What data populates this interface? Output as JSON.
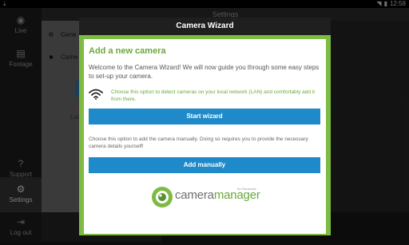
{
  "status_bar": {
    "time": "12:58"
  },
  "sidebar": {
    "items": [
      {
        "label": "Live",
        "icon": "eye-icon",
        "glyph": "◉"
      },
      {
        "label": "Footage",
        "icon": "film-icon",
        "glyph": "▤"
      },
      {
        "label": "Support",
        "icon": "question-icon",
        "glyph": "?"
      },
      {
        "label": "Settings",
        "icon": "gear-icon",
        "glyph": "⚙"
      },
      {
        "label": "Log out",
        "icon": "logout-icon",
        "glyph": "⇥"
      }
    ],
    "active": "Settings"
  },
  "header": {
    "title": "Settings"
  },
  "background_panel": {
    "rows": [
      {
        "label": "Gene",
        "icon": "gear-icon",
        "glyph": "⚙"
      },
      {
        "label": "Came",
        "icon": "camera-icon",
        "glyph": "■"
      }
    ],
    "fragment": "Loo"
  },
  "dialog": {
    "title": "Camera Wizard",
    "heading": "Add a new camera",
    "intro": "Welcome to the Camera Wizard! We will now guide you through some easy steps to set-up your camera.",
    "detect_text": "Choose this option to detect cameras on your local network (LAN) and comfortably add it from there.",
    "start_button": "Start wizard",
    "manual_text": "Choose this option to add the camera manually. Doing so requires you to provide the necessary camera details yourself!",
    "manual_button": "Add manually",
    "logo": {
      "part1": "camera",
      "part2": "manager",
      "small": "by Panasonic"
    }
  },
  "colors": {
    "accent_green": "#7dbb42",
    "button_blue": "#1f8ac9",
    "title_bar": "#1f1f1f"
  }
}
